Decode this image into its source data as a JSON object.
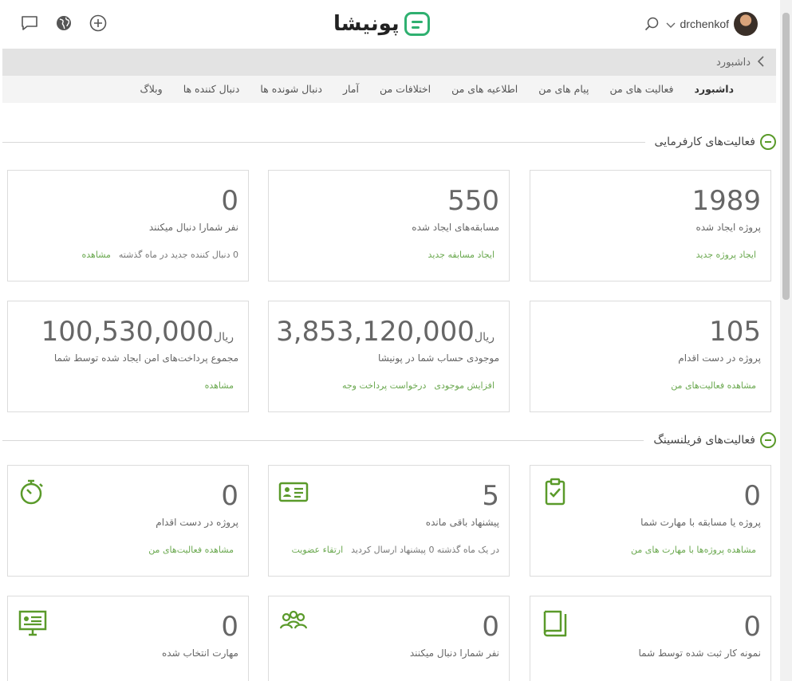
{
  "header": {
    "logo_text": "پونیشا",
    "username": "drchenkof",
    "icons": [
      "chat-icon",
      "globe-icon",
      "plus-circle-icon",
      "search-icon",
      "chevron-down-icon"
    ]
  },
  "breadcrumb": {
    "label": "داشبورد"
  },
  "tabs": [
    {
      "label": "داشبورد",
      "active": true
    },
    {
      "label": "فعالیت های من"
    },
    {
      "label": "پیام های من"
    },
    {
      "label": "اطلاعیه های من"
    },
    {
      "label": "اختلافات من"
    },
    {
      "label": "آمار"
    },
    {
      "label": "دنبال شونده ها"
    },
    {
      "label": "دنبال کننده ها"
    },
    {
      "label": "وبلاگ"
    }
  ],
  "employer": {
    "title": "فعالیت‌های کارفرمایی",
    "cards": [
      {
        "number": "1989",
        "label": "پروژه ایجاد شده",
        "link1": "ایجاد پروژه جدید"
      },
      {
        "number": "550",
        "label": "مسابقه‌های ایجاد شده",
        "link1": "ایجاد مسابقه جدید"
      },
      {
        "number": "0",
        "label": "نفر شمارا دنبال میکنند",
        "text": "0 دنبال کننده جدید در ماه گذشته",
        "link1": "مشاهده"
      },
      {
        "number": "105",
        "label": "پروژه در دست اقدام",
        "link1": "مشاهده فعالیت‌های من"
      },
      {
        "number": "3,853,120,000",
        "unit": "ریال",
        "label": "موجودی حساب شما در پونیشا",
        "link1": "افزایش موجودی",
        "link2": "درخواست پرداخت وجه"
      },
      {
        "number": "100,530,000",
        "unit": "ریال",
        "label": "مجموع پرداخت‌های امن ایجاد شده توسط شما",
        "link1": "مشاهده"
      }
    ]
  },
  "freelancer": {
    "title": "فعالیت‌های فریلنسینگ",
    "cards": [
      {
        "number": "0",
        "label": "پروژه یا مسابقه با مهارت شما",
        "link1": "مشاهده پروژه‌ها با مهارت های من",
        "icon": "clipboard-check-icon"
      },
      {
        "number": "5",
        "label": "پیشنهاد باقی مانده",
        "text": "در یک ماه گذشته 0 پیشنهاد ارسال کردید",
        "link1": "ارتقاء عضویت",
        "icon": "id-card-icon"
      },
      {
        "number": "0",
        "label": "پروژه در دست اقدام",
        "link1": "مشاهده فعالیت‌های من",
        "icon": "stopwatch-icon"
      },
      {
        "number": "0",
        "label": "نمونه کار ثبت شده توسط شما",
        "icon": "book-icon"
      },
      {
        "number": "0",
        "label": "نفر شمارا دنبال میکنند",
        "icon": "users-icon"
      },
      {
        "number": "0",
        "label": "مهارت انتخاب شده",
        "icon": "presentation-icon"
      }
    ]
  },
  "colors": {
    "accent": "#5a9a2a",
    "link": "#6aa84f",
    "logo": "#2fb070"
  }
}
